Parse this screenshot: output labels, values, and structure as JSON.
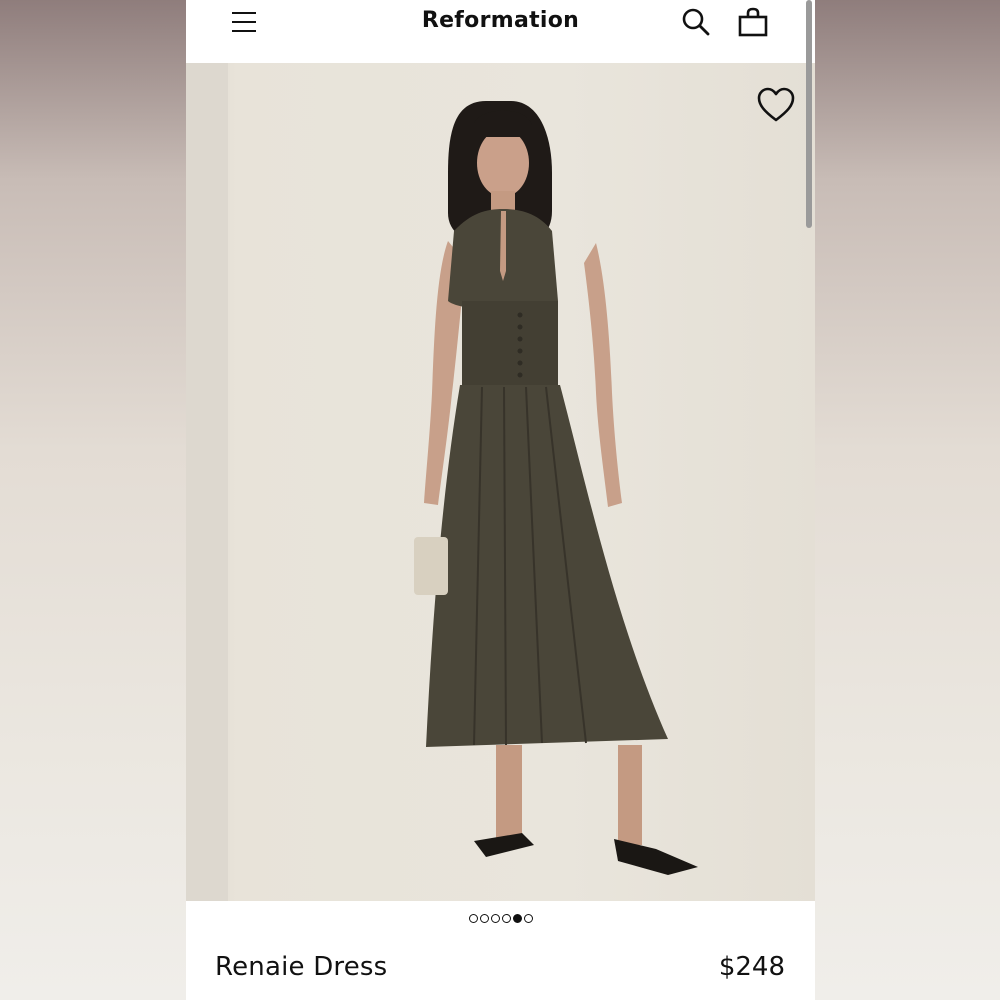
{
  "header": {
    "brand": "Reformation"
  },
  "icons": {
    "menu": "menu-icon",
    "search": "search-icon",
    "bag": "shopping-bag-icon",
    "wishlist": "heart-icon"
  },
  "carousel": {
    "total": 6,
    "active_index": 4
  },
  "product": {
    "name": "Renaie Dress",
    "price": "$248"
  },
  "colors": {
    "text": "#111111",
    "dress": "#4a4639",
    "background": "#e9e5dc"
  }
}
